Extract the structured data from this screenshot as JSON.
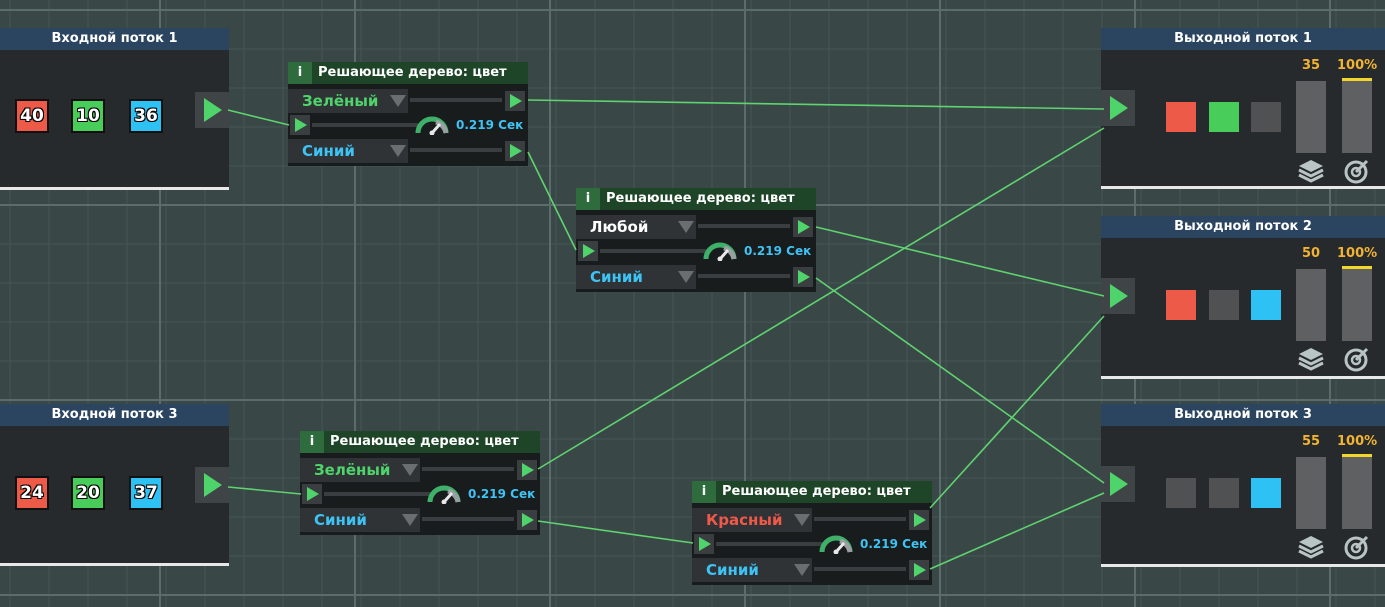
{
  "inputs": [
    {
      "title": "Входной поток 1",
      "values": [
        "40",
        "10",
        "36"
      ]
    },
    {
      "title": "Входной поток 3",
      "values": [
        "24",
        "20",
        "37"
      ]
    }
  ],
  "nodes": [
    {
      "info": "i",
      "title": "Решающее дерево: цвет",
      "top_option": "Зелёный",
      "bottom_option": "Синий",
      "speed": "0.219 Сек"
    },
    {
      "info": "i",
      "title": "Решающее дерево: цвет",
      "top_option": "Любой",
      "bottom_option": "Синий",
      "speed": "0.219 Сек"
    },
    {
      "info": "i",
      "title": "Решающее дерево: цвет",
      "top_option": "Зелёный",
      "bottom_option": "Синий",
      "speed": "0.219 Сек"
    },
    {
      "info": "i",
      "title": "Решающее дерево: цвет",
      "top_option": "Красный",
      "bottom_option": "Синий",
      "speed": "0.219 Сек"
    }
  ],
  "outputs": [
    {
      "title": "Выходной поток 1",
      "count": "35",
      "percent": "100%",
      "squares": [
        "red",
        "green",
        "gray"
      ],
      "level": 1.0
    },
    {
      "title": "Выходной поток 2",
      "count": "50",
      "percent": "100%",
      "squares": [
        "red",
        "gray",
        "blue"
      ],
      "level": 1.0
    },
    {
      "title": "Выходной поток 3",
      "count": "55",
      "percent": "100%",
      "squares": [
        "gray",
        "gray",
        "blue"
      ],
      "level": 1.0
    }
  ],
  "colors": {
    "background": "#3a4747",
    "wire": "#5fd36f",
    "red": "#ee5a48",
    "green": "#48cc5a",
    "blue": "#2ec1f4",
    "gray": "#4f5153",
    "accent_yellow": "#f2d72a"
  },
  "icons": {
    "layers": "layers-icon",
    "target": "target-icon",
    "gauge": "gauge-icon",
    "play": "play-icon"
  }
}
